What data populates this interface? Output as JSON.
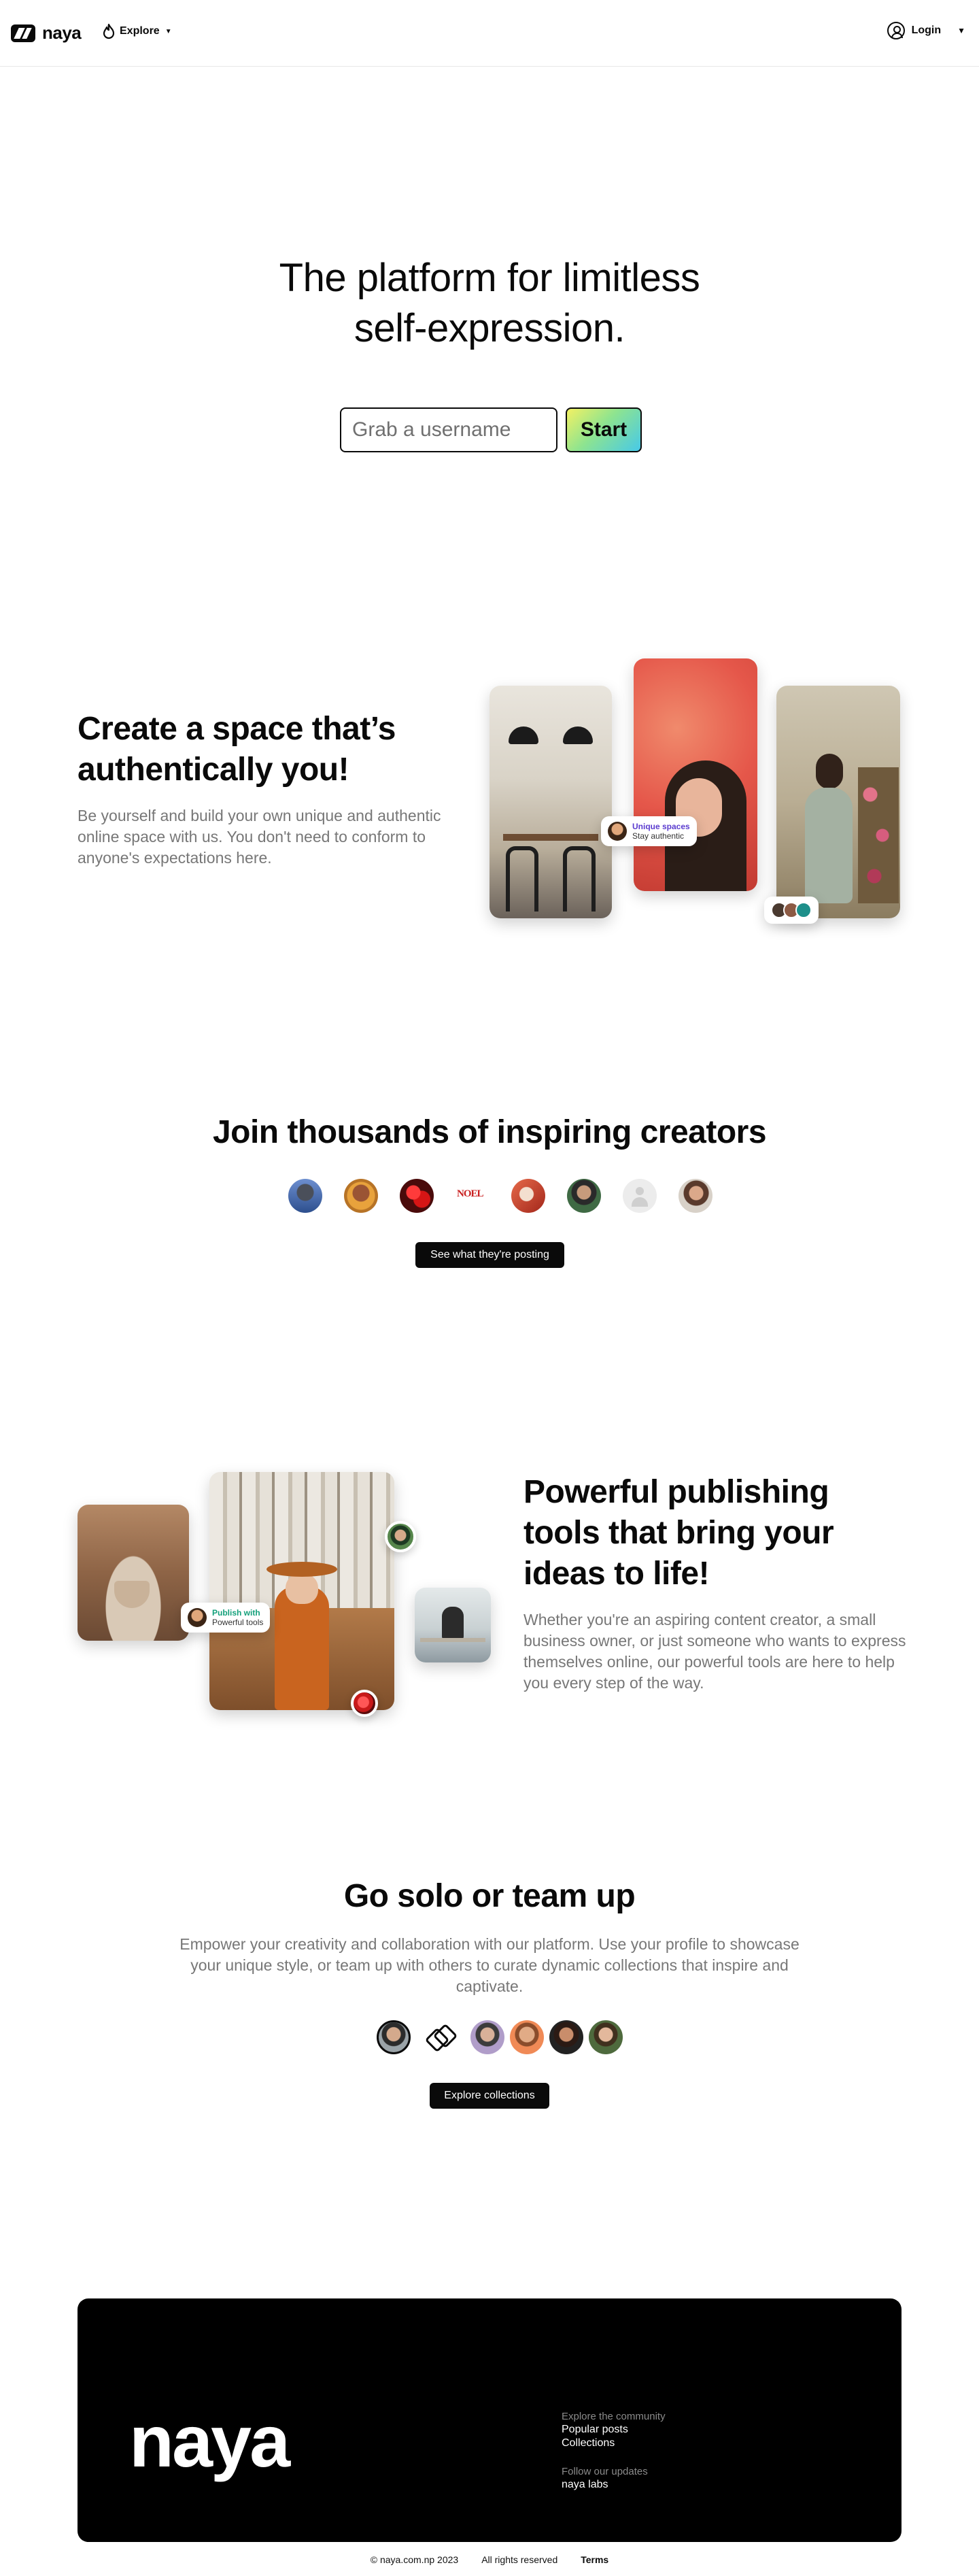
{
  "header": {
    "logo_text": "naya",
    "explore_label": "Explore",
    "login_label": "Login"
  },
  "hero": {
    "title_line1": "The platform for limitless",
    "title_line2": "self-expression.",
    "username_placeholder": "Grab a username",
    "start_label": "Start"
  },
  "section_space": {
    "title": "Create a space that’s authentically you!",
    "description": "Be yourself and build your own unique and authentic online space with us. You don't need to conform to anyone's expectations here.",
    "badge_title": "Unique spaces",
    "badge_subtitle": "Stay authentic",
    "stack_colors": [
      "#4a3a30",
      "#8c5a44",
      "#1d8f8a"
    ]
  },
  "section_creators": {
    "title": "Join thousands of inspiring creators",
    "creator_logo_text": "NOEL",
    "cta_label": "See what they're posting"
  },
  "section_publishing": {
    "title": "Powerful publishing tools that bring your ideas to life!",
    "description": "Whether you're an aspiring content creator, a small business owner, or just someone who wants to express themselves online, our powerful tools are here to help you every step of the way.",
    "badge_title": "Publish with",
    "badge_subtitle": "Powerful tools"
  },
  "section_team": {
    "title": "Go solo or team up",
    "description": "Empower your creativity and collaboration with our platform. Use your profile to showcase your unique style, or team up with others to curate dynamic collections that inspire and captivate.",
    "cta_label": "Explore collections"
  },
  "footer": {
    "logo_text": "naya",
    "explore_heading": "Explore the community",
    "link_popular": "Popular posts",
    "link_collections": "Collections",
    "updates_heading": "Follow our updates",
    "link_labs": "naya labs",
    "copyright": "© naya.com.np 2023",
    "rights": "All rights reserved",
    "terms": "Terms"
  }
}
